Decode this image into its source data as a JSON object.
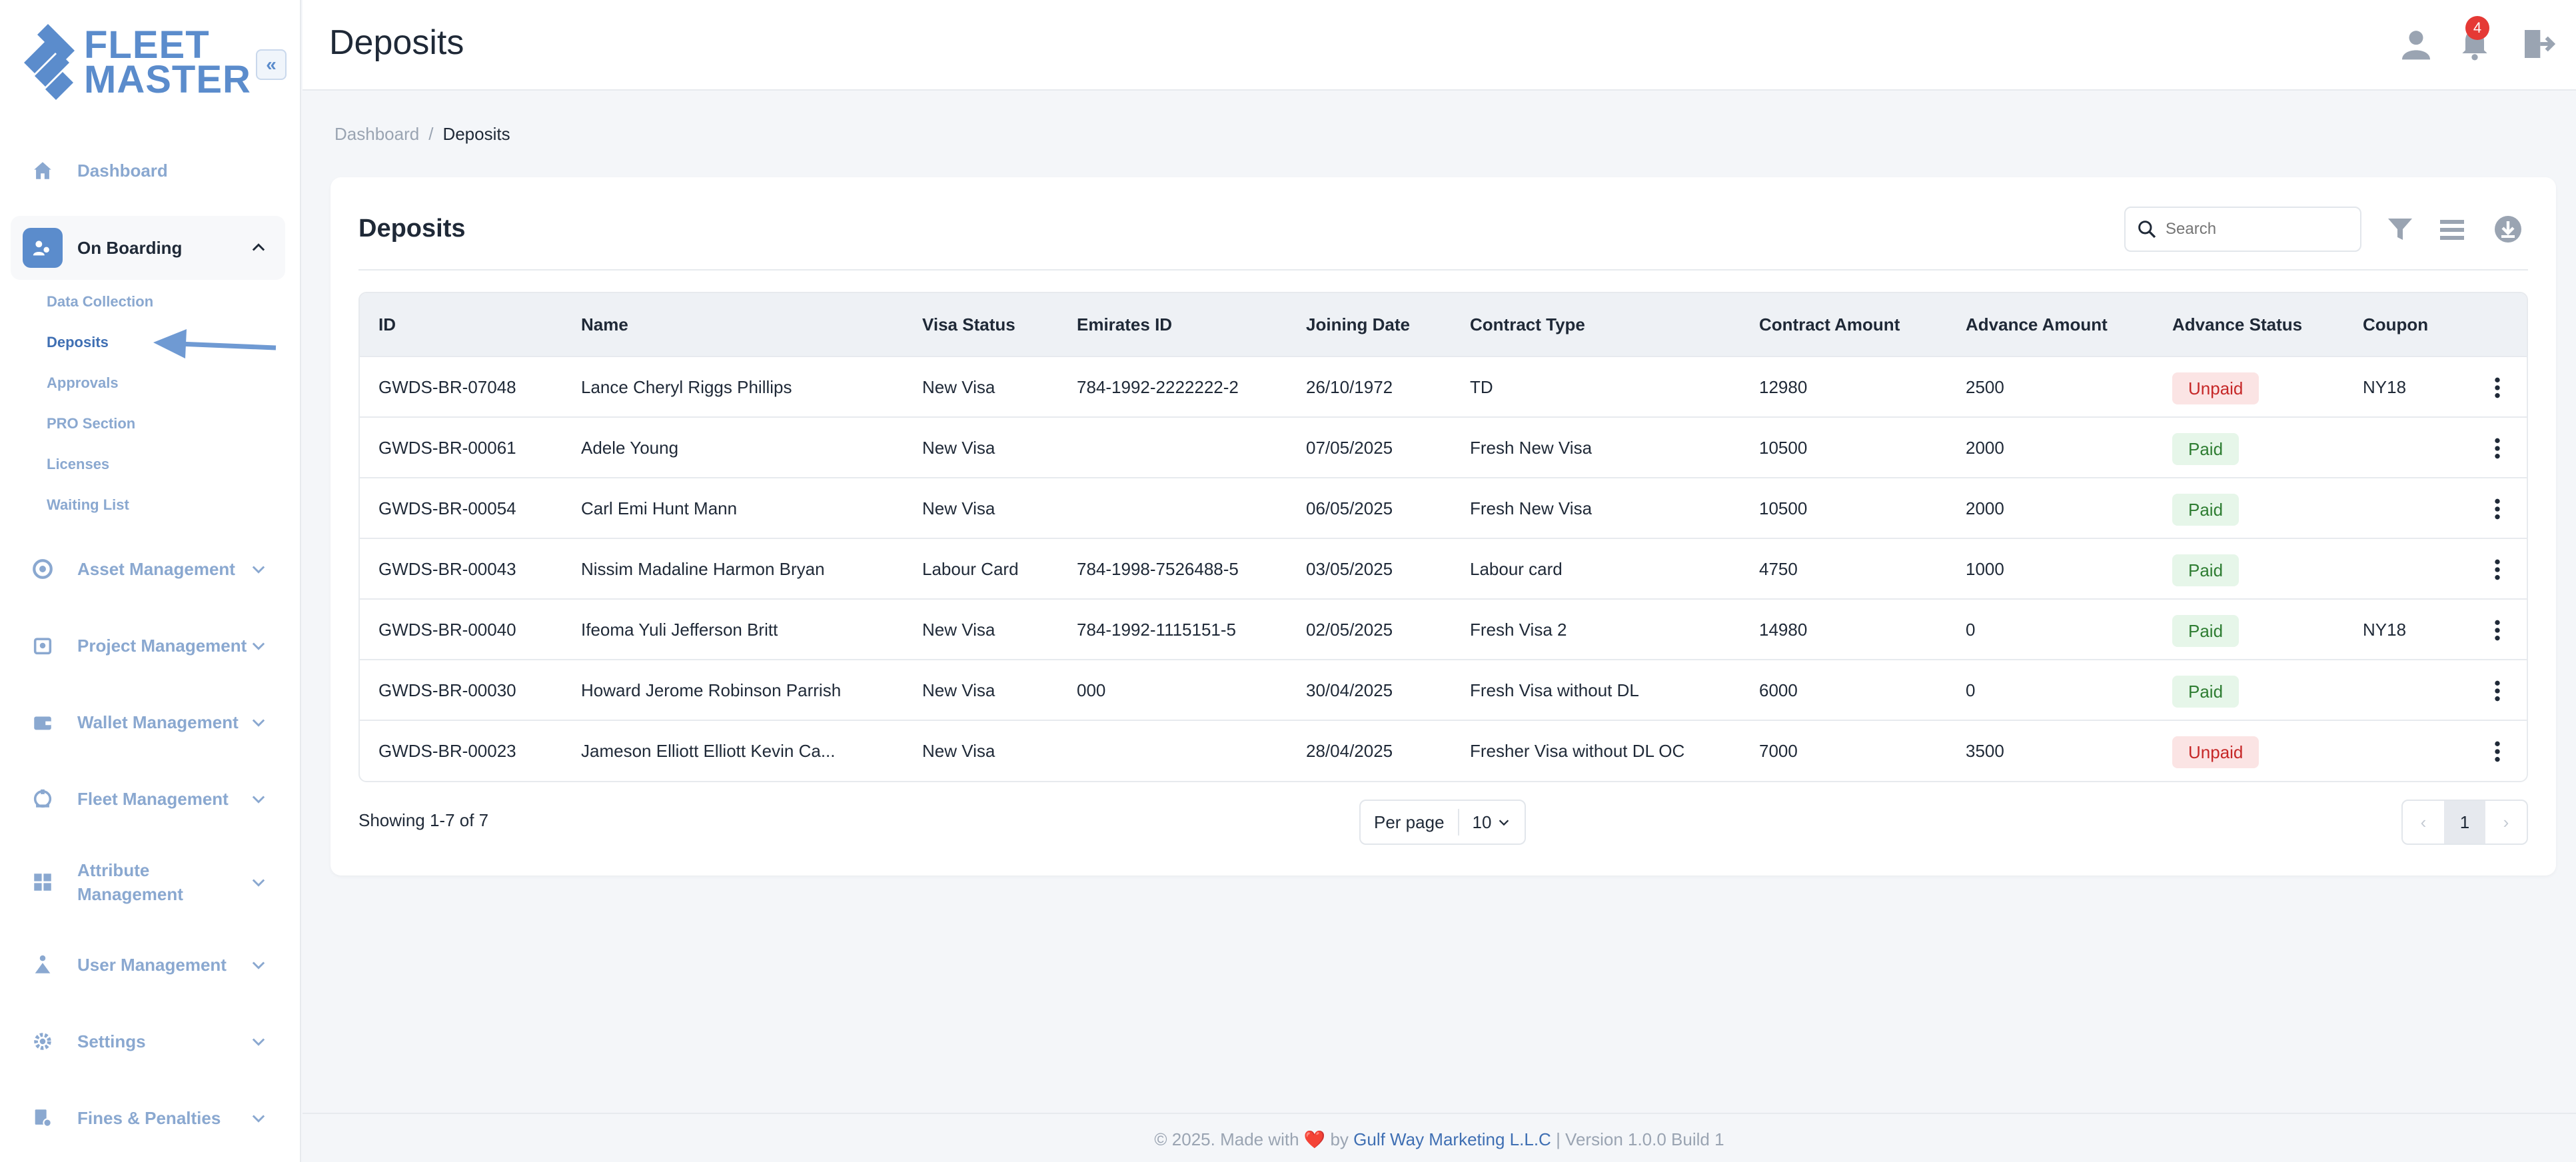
{
  "brand": {
    "line1": "FLEET",
    "line2": "MASTER"
  },
  "sidebar": {
    "items": [
      {
        "label": "Dashboard",
        "icon": "home-icon"
      },
      {
        "label": "On Boarding",
        "icon": "onboarding-icon",
        "active": true
      },
      {
        "label": "Asset Management",
        "icon": "asset-icon"
      },
      {
        "label": "Project Management",
        "icon": "project-icon"
      },
      {
        "label": "Wallet Management",
        "icon": "wallet-icon"
      },
      {
        "label": "Fleet Management",
        "icon": "fleet-icon"
      },
      {
        "label": "Attribute Management",
        "icon": "attribute-icon"
      },
      {
        "label": "User Management",
        "icon": "users-icon"
      },
      {
        "label": "Settings",
        "icon": "gear-icon"
      },
      {
        "label": "Fines & Penalties",
        "icon": "fines-icon"
      }
    ],
    "sub_items": [
      "Data Collection",
      "Deposits",
      "Approvals",
      "PRO Section",
      "Licenses",
      "Waiting List"
    ]
  },
  "header": {
    "title": "Deposits",
    "notification_count": "4"
  },
  "breadcrumb": {
    "home": "Dashboard",
    "separator": "/",
    "current": "Deposits"
  },
  "card": {
    "title": "Deposits",
    "search": {
      "placeholder": "Search",
      "value": ""
    }
  },
  "table": {
    "columns": [
      "ID",
      "Name",
      "Visa Status",
      "Emirates ID",
      "Joining Date",
      "Contract Type",
      "Contract Amount",
      "Advance Amount",
      "Advance Status",
      "Coupon"
    ],
    "rows": [
      [
        "GWDS-BR-07048",
        "Lance Cheryl Riggs Phillips",
        "New Visa",
        "784-1992-2222222-2",
        "26/10/1972",
        "TD",
        "12980",
        "2500",
        "Unpaid",
        "NY18"
      ],
      [
        "GWDS-BR-00061",
        "Adele Young",
        "New Visa",
        "",
        "07/05/2025",
        "Fresh New Visa",
        "10500",
        "2000",
        "Paid",
        ""
      ],
      [
        "GWDS-BR-00054",
        "Carl Emi Hunt Mann",
        "New Visa",
        "",
        "06/05/2025",
        "Fresh New Visa",
        "10500",
        "2000",
        "Paid",
        ""
      ],
      [
        "GWDS-BR-00043",
        "Nissim Madaline Harmon Bryan",
        "Labour Card",
        "784-1998-7526488-5",
        "03/05/2025",
        "Labour card",
        "4750",
        "1000",
        "Paid",
        ""
      ],
      [
        "GWDS-BR-00040",
        "Ifeoma Yuli Jefferson Britt",
        "New Visa",
        "784-1992-1115151-5",
        "02/05/2025",
        "Fresh Visa 2",
        "14980",
        "0",
        "Paid",
        "NY18"
      ],
      [
        "GWDS-BR-00030",
        "Howard Jerome Robinson Parrish",
        "New Visa",
        "000",
        "30/04/2025",
        "Fresh Visa without DL",
        "6000",
        "0",
        "Paid",
        ""
      ],
      [
        "GWDS-BR-00023",
        "Jameson Elliott Elliott Kevin Ca...",
        "New Visa",
        "",
        "28/04/2025",
        "Fresher Visa without DL OC",
        "7000",
        "3500",
        "Unpaid",
        ""
      ]
    ]
  },
  "pagination": {
    "showing": "Showing 1-7 of 7",
    "per_page_label": "Per page",
    "per_page_value": "10",
    "current_page": "1"
  },
  "footer": {
    "prefix": "© 2025. Made with",
    "heart": "❤️",
    "by": "by",
    "company": "Gulf Way Marketing L.L.C",
    "version": "| Version 1.0.0 Build 1"
  },
  "colors": {
    "accent": "#5b8ccc",
    "paid_bg": "#e6f6e9",
    "paid_text": "#2e7d32",
    "unpaid_bg": "#fbe4e4",
    "unpaid_text": "#c62828",
    "badge": "#e53935"
  }
}
